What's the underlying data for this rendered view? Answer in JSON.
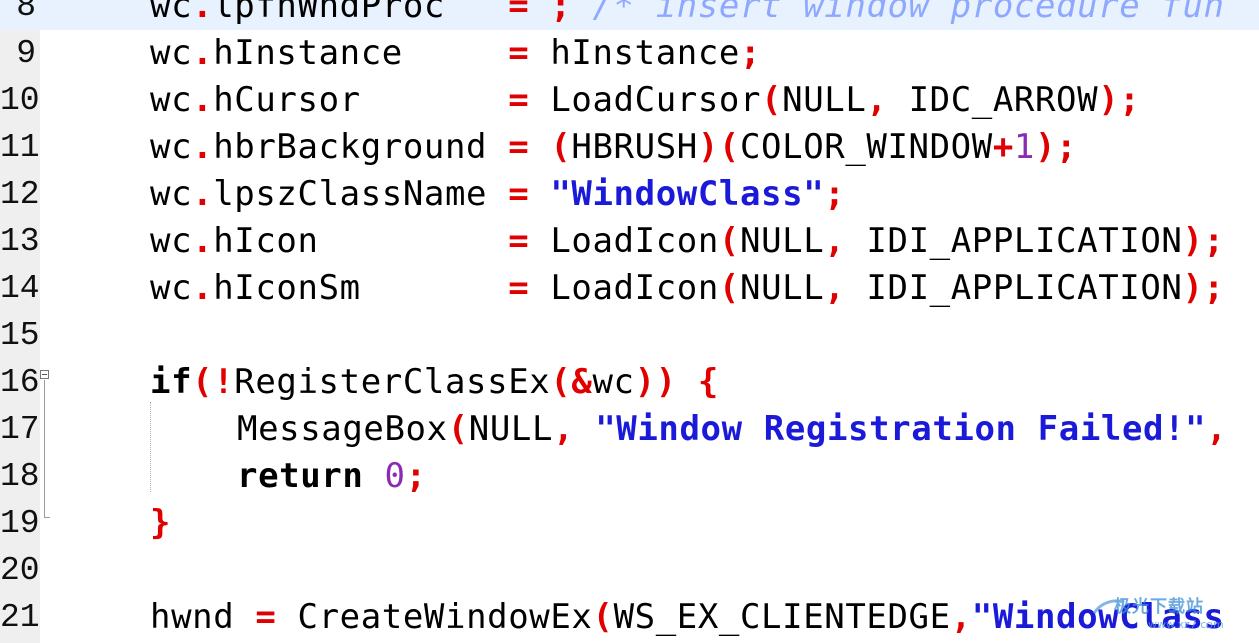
{
  "editor": {
    "lines": [
      {
        "num": "8",
        "tokens": [
          [
            "id",
            "wc"
          ],
          [
            "op",
            "."
          ],
          [
            "id",
            "lpfnWndProc   "
          ],
          [
            "op",
            "= ;"
          ],
          [
            "cm",
            " /* insert window procedure fun"
          ]
        ]
      },
      {
        "num": "9",
        "tokens": [
          [
            "id",
            "wc"
          ],
          [
            "op",
            "."
          ],
          [
            "id",
            "hInstance     "
          ],
          [
            "op",
            "="
          ],
          [
            "id",
            " hInstance"
          ],
          [
            "op",
            ";"
          ]
        ]
      },
      {
        "num": "10",
        "tokens": [
          [
            "id",
            "wc"
          ],
          [
            "op",
            "."
          ],
          [
            "id",
            "hCursor       "
          ],
          [
            "op",
            "="
          ],
          [
            "id",
            " LoadCursor"
          ],
          [
            "op",
            "("
          ],
          [
            "id",
            "NULL"
          ],
          [
            "op",
            ","
          ],
          [
            "id",
            " IDC_ARROW"
          ],
          [
            "op",
            ");"
          ]
        ]
      },
      {
        "num": "11",
        "tokens": [
          [
            "id",
            "wc"
          ],
          [
            "op",
            "."
          ],
          [
            "id",
            "hbrBackground "
          ],
          [
            "op",
            "= ("
          ],
          [
            "id",
            "HBRUSH"
          ],
          [
            "op",
            ")("
          ],
          [
            "id",
            "COLOR_WINDOW"
          ],
          [
            "op",
            "+"
          ],
          [
            "num",
            "1"
          ],
          [
            "op",
            ");"
          ]
        ]
      },
      {
        "num": "12",
        "tokens": [
          [
            "id",
            "wc"
          ],
          [
            "op",
            "."
          ],
          [
            "id",
            "lpszClassName "
          ],
          [
            "op",
            "="
          ],
          [
            "str",
            " \"WindowClass\""
          ],
          [
            "op",
            ";"
          ]
        ]
      },
      {
        "num": "13",
        "tokens": [
          [
            "id",
            "wc"
          ],
          [
            "op",
            "."
          ],
          [
            "id",
            "hIcon         "
          ],
          [
            "op",
            "="
          ],
          [
            "id",
            " LoadIcon"
          ],
          [
            "op",
            "("
          ],
          [
            "id",
            "NULL"
          ],
          [
            "op",
            ","
          ],
          [
            "id",
            " IDI_APPLICATION"
          ],
          [
            "op",
            ");"
          ]
        ]
      },
      {
        "num": "14",
        "tokens": [
          [
            "id",
            "wc"
          ],
          [
            "op",
            "."
          ],
          [
            "id",
            "hIconSm       "
          ],
          [
            "op",
            "="
          ],
          [
            "id",
            " LoadIcon"
          ],
          [
            "op",
            "("
          ],
          [
            "id",
            "NULL"
          ],
          [
            "op",
            ","
          ],
          [
            "id",
            " IDI_APPLICATION"
          ],
          [
            "op",
            ");"
          ]
        ]
      },
      {
        "num": "15",
        "tokens": []
      },
      {
        "num": "16",
        "tokens": [
          [
            "kw",
            "if"
          ],
          [
            "op",
            "(!"
          ],
          [
            "id",
            "RegisterClassEx"
          ],
          [
            "op",
            "(&"
          ],
          [
            "id",
            "wc"
          ],
          [
            "op",
            ")) {"
          ]
        ]
      },
      {
        "num": "17",
        "indent": true,
        "tokens": [
          [
            "id",
            "MessageBox"
          ],
          [
            "op",
            "("
          ],
          [
            "id",
            "NULL"
          ],
          [
            "op",
            ","
          ],
          [
            "str",
            " \"Window Registration Failed!\""
          ],
          [
            "op",
            ","
          ]
        ]
      },
      {
        "num": "18",
        "indent": true,
        "tokens": [
          [
            "kw",
            "return"
          ],
          [
            "id",
            " "
          ],
          [
            "num",
            "0"
          ],
          [
            "op",
            ";"
          ]
        ]
      },
      {
        "num": "19",
        "tokens": [
          [
            "op",
            "}"
          ]
        ]
      },
      {
        "num": "20",
        "tokens": []
      },
      {
        "num": "21",
        "tokens": [
          [
            "id",
            "hwnd "
          ],
          [
            "op",
            "="
          ],
          [
            "id",
            " CreateWindowEx"
          ],
          [
            "op",
            "("
          ],
          [
            "id",
            "WS_EX_CLIENTEDGE"
          ],
          [
            "op",
            ","
          ],
          [
            "str",
            "\"WindowClass"
          ]
        ]
      }
    ]
  },
  "watermark": {
    "text": "极光下载站",
    "sub": "www.xz7.com"
  }
}
